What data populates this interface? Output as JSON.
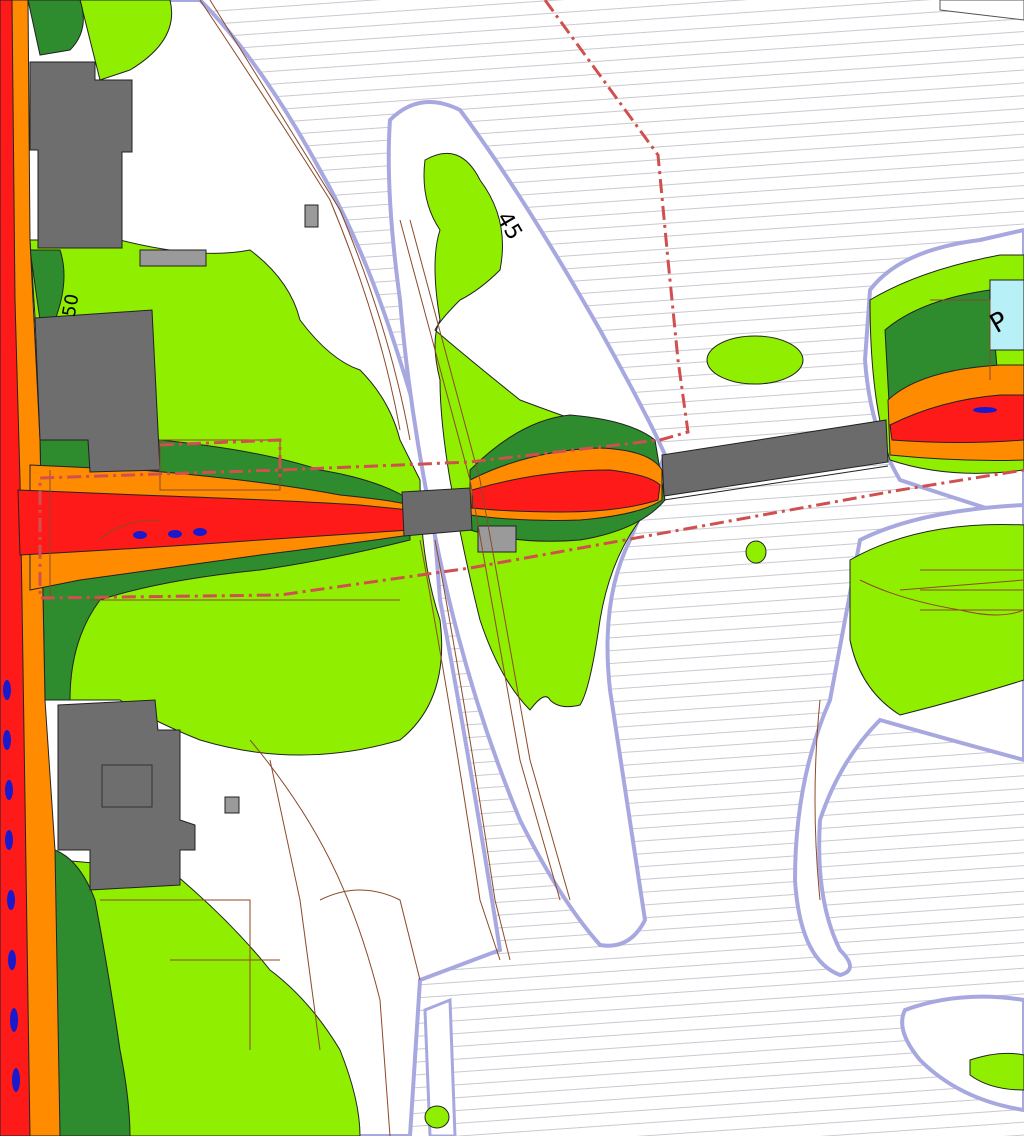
{
  "map": {
    "contour_labels": {
      "c45": "45",
      "c50": "50",
      "parking_sign": "P"
    },
    "colors": {
      "water": "#ffffff",
      "water_hatch": "#c8c8d0",
      "shore_outline": "#a8a8e0",
      "zone_light_green": "#90ee00",
      "zone_dark_green": "#2e8b2e",
      "zone_orange": "#ff8c00",
      "zone_red": "#ff1a1a",
      "zone_blue": "#1a1acc",
      "building": "#6e6e6e",
      "bridge": "#6b6b6b",
      "plan_boundary": "#d05050",
      "terrain_line": "#8b4a2a",
      "parking_fill": "#b8f0f8"
    }
  }
}
